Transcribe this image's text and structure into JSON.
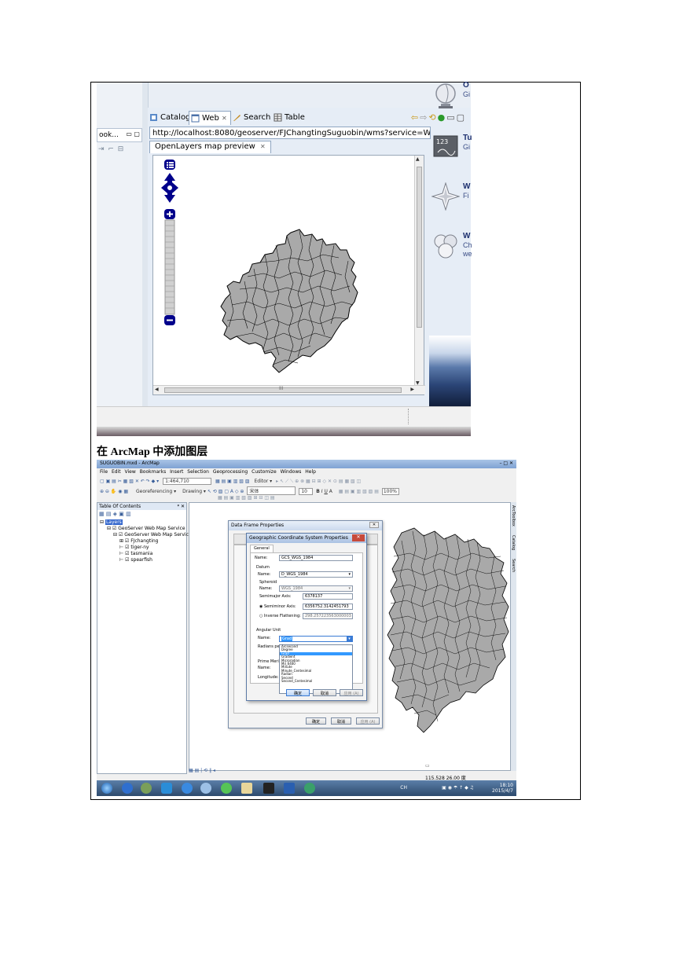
{
  "caption": "在 ArcMap 中添加图层",
  "eclipse": {
    "left_mini_tab": "ook...",
    "tabs": [
      {
        "label": "Catalog",
        "icon": "catalog-icon"
      },
      {
        "label": "Web",
        "icon": "web-icon",
        "close": "✕"
      },
      {
        "label": "Search",
        "icon": "search-icon"
      },
      {
        "label": "Table",
        "icon": "table-icon"
      }
    ],
    "url": "http://localhost:8080/geoserver/FJChangtingSuguobin/wms?service=WMS&version",
    "preview_tab": "OpenLayers map preview",
    "preview_close": "✕",
    "scroll_ellipsis": "III"
  },
  "welcome": {
    "items": [
      {
        "title": "O",
        "subtitle": "Gi",
        "icon": "globe-icon"
      },
      {
        "title": "Tu",
        "subtitle": "Gi",
        "icon": "tutorial-icon"
      },
      {
        "title": "W",
        "subtitle": "Fi",
        "icon": "compass-star-icon"
      },
      {
        "title": "W",
        "subtitle": "Ch\nwe",
        "icon": "samples-icon"
      }
    ]
  },
  "arcmap": {
    "title": "SUGUOBIN.mxd - ArcMap",
    "window_controls": "–  □  ✕",
    "menu": [
      "File",
      "Edit",
      "View",
      "Bookmarks",
      "Insert",
      "Selection",
      "Geoprocessing",
      "Customize",
      "Windows",
      "Help"
    ],
    "toolbar1": "1:464,710",
    "toolbar1_editor": "Editor ▾",
    "toolbar2_georef": "Georeferencing ▾",
    "toolbar2_drawing": "Drawing ▾",
    "toolbar2_font": "宋体",
    "toolbar2_size": "10",
    "toolbar2_zoom": "100%",
    "toc_title": "Table Of Contents",
    "toc": [
      {
        "label": "Layers",
        "level": 0
      },
      {
        "label": "GeoServer Web Map Service",
        "level": 1
      },
      {
        "label": "GeoServer Web Map Service",
        "level": 2
      },
      {
        "label": "FJchangting",
        "level": 3
      },
      {
        "label": "tiger-ny",
        "level": 3
      },
      {
        "label": "tasmania",
        "level": 3
      },
      {
        "label": "spearfish",
        "level": 3
      }
    ],
    "right_tabs": [
      "ArcToolbox",
      "Catalog",
      "Search"
    ],
    "status_coords": "115.528  26.00 度",
    "tray_time": "18:10",
    "tray_date": "2015/4/7",
    "tray_lang": "CH"
  },
  "dialog_back": {
    "title": "Data Frame Properties",
    "ok": "确定",
    "cancel": "取消",
    "apply": "应用 (A)"
  },
  "dialog": {
    "title": "Geographic Coordinate System Properties",
    "tab": "General",
    "name_label": "Name:",
    "name_value": "GCS_WGS_1984",
    "datum_label": "Datum",
    "datum_name_label": "Name:",
    "datum_name_value": "D_WGS_1984",
    "spheroid_label": "Spheroid",
    "spheroid_name_label": "Name:",
    "spheroid_name_value": "WGS_1984",
    "semimajor_label": "Semimajor Axis:",
    "semimajor_value": "6378137",
    "semiminor_label": "Semiminor Axis:",
    "semiminor_value": "6356752.3142451793",
    "inv_flat_label": "Inverse Flattening:",
    "inv_flat_value": "298.257223563000003",
    "angular_label": "Angular Unit",
    "angular_name_label": "Name:",
    "angular_name_value": "Grad",
    "radians_label": "Radians per unit:",
    "prime_label": "Prime Meridian",
    "prime_name_label": "Name:",
    "longitude_label": "Longitude:",
    "ok": "确定",
    "cancel": "取消",
    "apply": "应用 (A)",
    "close": "✕",
    "options": [
      "Arcsecond",
      "Degree",
      "Grad",
      "Gradient",
      "Microradian",
      "Mil_6400",
      "Minute",
      "Minute_Centesimal",
      "Radian",
      "Second",
      "Second_Centesimal"
    ],
    "selected_option": "Grad"
  }
}
